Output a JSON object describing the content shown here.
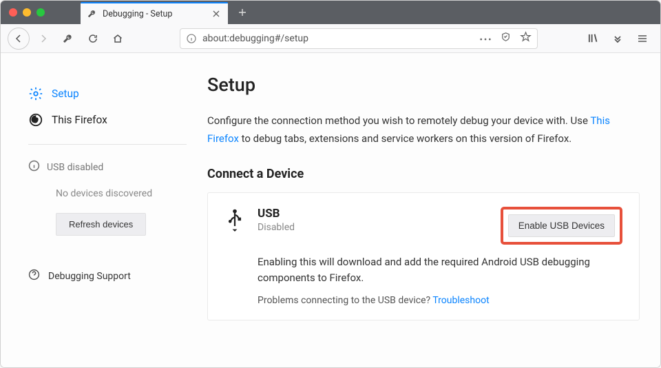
{
  "tab": {
    "title": "Debugging - Setup"
  },
  "url": "about:debugging#/setup",
  "sidebar": {
    "setup": "Setup",
    "this_firefox": "This Firefox",
    "usb_disabled": "USB disabled",
    "no_devices": "No devices discovered",
    "refresh": "Refresh devices",
    "support": "Debugging Support"
  },
  "main": {
    "heading": "Setup",
    "intro_before": "Configure the connection method you wish to remotely debug your device with. Use ",
    "intro_link": "This Firefox",
    "intro_after": " to debug tabs, extensions and service workers on this version of Firefox.",
    "connect_heading": "Connect a Device",
    "usb": {
      "title": "USB",
      "status": "Disabled",
      "enable_btn": "Enable USB Devices",
      "desc": "Enabling this will download and add the required Android USB debugging components to Firefox.",
      "trouble_before": "Problems connecting to the USB device? ",
      "trouble_link": "Troubleshoot"
    }
  }
}
